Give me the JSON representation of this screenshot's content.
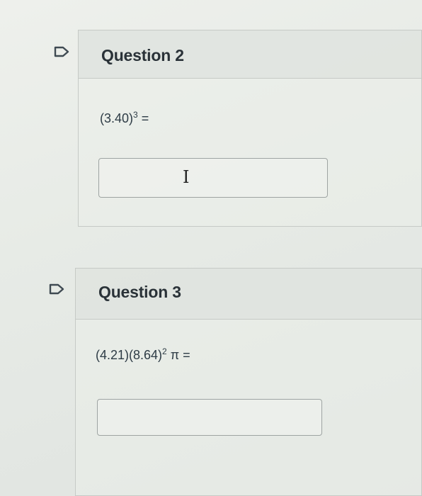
{
  "questions": [
    {
      "title": "Question 2",
      "expr_base": "(3.40)",
      "expr_exp": "3",
      "expr_tail": " =",
      "answer_value": ""
    },
    {
      "title": "Question 3",
      "expr_base": "(4.21)(8.64)",
      "expr_exp": "2",
      "expr_tail": " π =",
      "answer_value": ""
    }
  ],
  "cursor_glyph": "I",
  "icons": {
    "flag": "flag-question-icon",
    "cursor": "text-cursor-icon"
  },
  "colors": {
    "flag_stroke": "#3f4a52",
    "title": "#2a3238",
    "text": "#2d3b45"
  }
}
